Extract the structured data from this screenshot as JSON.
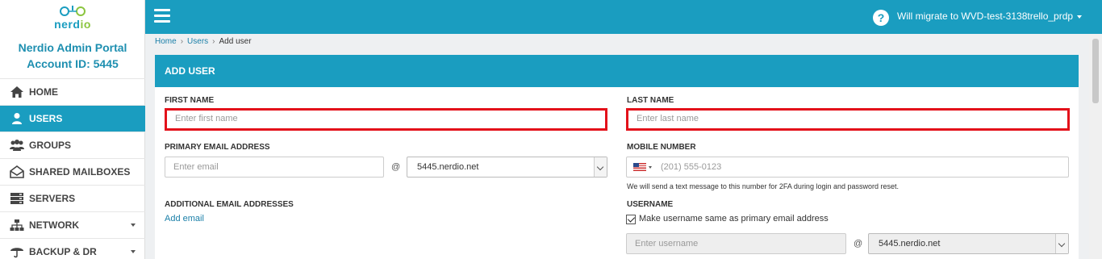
{
  "logo": {
    "text_a": "nerd",
    "text_b": "io"
  },
  "portal": {
    "title": "Nerdio Admin Portal",
    "account": "Account ID: 5445"
  },
  "nav": {
    "home": "HOME",
    "users": "USERS",
    "groups": "GROUPS",
    "shared_mailboxes": "SHARED MAILBOXES",
    "servers": "SERVERS",
    "network": "NETWORK",
    "backup": "BACKUP & DR"
  },
  "topbar": {
    "help": "?",
    "migrate": "Will migrate to WVD-test-3138trello_prdp"
  },
  "breadcrumb": {
    "home": "Home",
    "users": "Users",
    "current": "Add user"
  },
  "panel": {
    "title": "ADD USER"
  },
  "form": {
    "first_name": {
      "label": "FIRST NAME",
      "placeholder": "Enter first name"
    },
    "last_name": {
      "label": "LAST NAME",
      "placeholder": "Enter last name"
    },
    "primary_email": {
      "label": "PRIMARY EMAIL ADDRESS",
      "placeholder": "Enter email",
      "at": "@",
      "domain": "5445.nerdio.net"
    },
    "mobile": {
      "label": "MOBILE NUMBER",
      "placeholder": "(201) 555-0123",
      "hint": "We will send a text message to this number for 2FA during login and password reset."
    },
    "additional_email": {
      "label": "ADDITIONAL EMAIL ADDRESSES",
      "add_link": "Add email"
    },
    "username": {
      "label": "USERNAME",
      "checkbox_label": "Make username same as primary email address",
      "placeholder": "Enter username",
      "at": "@",
      "domain": "5445.nerdio.net"
    }
  },
  "colors": {
    "accent": "#1a9dc0",
    "highlight": "#e3111a",
    "logo_green": "#8bc53f"
  }
}
